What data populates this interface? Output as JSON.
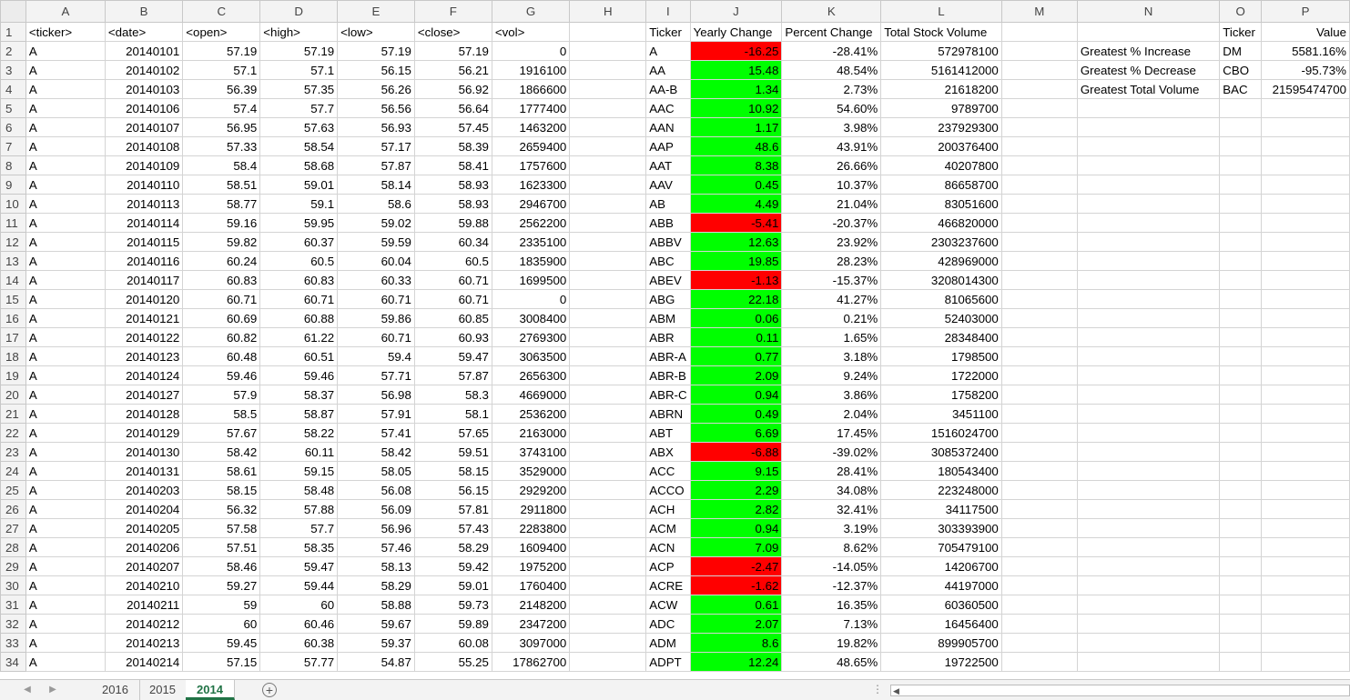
{
  "columns": [
    "A",
    "B",
    "C",
    "D",
    "E",
    "F",
    "G",
    "H",
    "I",
    "J",
    "K",
    "L",
    "M",
    "N",
    "O",
    "P"
  ],
  "rows": [
    {
      "n": "1",
      "A": "<ticker>",
      "B": "<date>",
      "C": "<open>",
      "D": "<high>",
      "E": "<low>",
      "F": "<close>",
      "G": "<vol>",
      "I": "Ticker",
      "J": "Yearly Change",
      "K": "Percent Change",
      "L": "Total Stock Volume",
      "O": "Ticker",
      "P": "Value"
    },
    {
      "n": "2",
      "A": "A",
      "B": "20140101",
      "C": "57.19",
      "D": "57.19",
      "E": "57.19",
      "F": "57.19",
      "G": "0",
      "I": "A",
      "J": "-16.25",
      "K": "-28.41%",
      "L": "572978100",
      "N": "Greatest % Increase",
      "O": "DM",
      "P": "5581.16%"
    },
    {
      "n": "3",
      "A": "A",
      "B": "20140102",
      "C": "57.1",
      "D": "57.1",
      "E": "56.15",
      "F": "56.21",
      "G": "1916100",
      "I": "AA",
      "J": "15.48",
      "K": "48.54%",
      "L": "5161412000",
      "N": "Greatest % Decrease",
      "O": "CBO",
      "P": "-95.73%"
    },
    {
      "n": "4",
      "A": "A",
      "B": "20140103",
      "C": "56.39",
      "D": "57.35",
      "E": "56.26",
      "F": "56.92",
      "G": "1866600",
      "I": "AA-B",
      "J": "1.34",
      "K": "2.73%",
      "L": "21618200",
      "N": "Greatest Total Volume",
      "O": "BAC",
      "P": "21595474700"
    },
    {
      "n": "5",
      "A": "A",
      "B": "20140106",
      "C": "57.4",
      "D": "57.7",
      "E": "56.56",
      "F": "56.64",
      "G": "1777400",
      "I": "AAC",
      "J": "10.92",
      "K": "54.60%",
      "L": "9789700"
    },
    {
      "n": "6",
      "A": "A",
      "B": "20140107",
      "C": "56.95",
      "D": "57.63",
      "E": "56.93",
      "F": "57.45",
      "G": "1463200",
      "I": "AAN",
      "J": "1.17",
      "K": "3.98%",
      "L": "237929300"
    },
    {
      "n": "7",
      "A": "A",
      "B": "20140108",
      "C": "57.33",
      "D": "58.54",
      "E": "57.17",
      "F": "58.39",
      "G": "2659400",
      "I": "AAP",
      "J": "48.6",
      "K": "43.91%",
      "L": "200376400"
    },
    {
      "n": "8",
      "A": "A",
      "B": "20140109",
      "C": "58.4",
      "D": "58.68",
      "E": "57.87",
      "F": "58.41",
      "G": "1757600",
      "I": "AAT",
      "J": "8.38",
      "K": "26.66%",
      "L": "40207800"
    },
    {
      "n": "9",
      "A": "A",
      "B": "20140110",
      "C": "58.51",
      "D": "59.01",
      "E": "58.14",
      "F": "58.93",
      "G": "1623300",
      "I": "AAV",
      "J": "0.45",
      "K": "10.37%",
      "L": "86658700"
    },
    {
      "n": "10",
      "A": "A",
      "B": "20140113",
      "C": "58.77",
      "D": "59.1",
      "E": "58.6",
      "F": "58.93",
      "G": "2946700",
      "I": "AB",
      "J": "4.49",
      "K": "21.04%",
      "L": "83051600"
    },
    {
      "n": "11",
      "A": "A",
      "B": "20140114",
      "C": "59.16",
      "D": "59.95",
      "E": "59.02",
      "F": "59.88",
      "G": "2562200",
      "I": "ABB",
      "J": "-5.41",
      "K": "-20.37%",
      "L": "466820000"
    },
    {
      "n": "12",
      "A": "A",
      "B": "20140115",
      "C": "59.82",
      "D": "60.37",
      "E": "59.59",
      "F": "60.34",
      "G": "2335100",
      "I": "ABBV",
      "J": "12.63",
      "K": "23.92%",
      "L": "2303237600"
    },
    {
      "n": "13",
      "A": "A",
      "B": "20140116",
      "C": "60.24",
      "D": "60.5",
      "E": "60.04",
      "F": "60.5",
      "G": "1835900",
      "I": "ABC",
      "J": "19.85",
      "K": "28.23%",
      "L": "428969000"
    },
    {
      "n": "14",
      "A": "A",
      "B": "20140117",
      "C": "60.83",
      "D": "60.83",
      "E": "60.33",
      "F": "60.71",
      "G": "1699500",
      "I": "ABEV",
      "J": "-1.13",
      "K": "-15.37%",
      "L": "3208014300"
    },
    {
      "n": "15",
      "A": "A",
      "B": "20140120",
      "C": "60.71",
      "D": "60.71",
      "E": "60.71",
      "F": "60.71",
      "G": "0",
      "I": "ABG",
      "J": "22.18",
      "K": "41.27%",
      "L": "81065600"
    },
    {
      "n": "16",
      "A": "A",
      "B": "20140121",
      "C": "60.69",
      "D": "60.88",
      "E": "59.86",
      "F": "60.85",
      "G": "3008400",
      "I": "ABM",
      "J": "0.06",
      "K": "0.21%",
      "L": "52403000"
    },
    {
      "n": "17",
      "A": "A",
      "B": "20140122",
      "C": "60.82",
      "D": "61.22",
      "E": "60.71",
      "F": "60.93",
      "G": "2769300",
      "I": "ABR",
      "J": "0.11",
      "K": "1.65%",
      "L": "28348400"
    },
    {
      "n": "18",
      "A": "A",
      "B": "20140123",
      "C": "60.48",
      "D": "60.51",
      "E": "59.4",
      "F": "59.47",
      "G": "3063500",
      "I": "ABR-A",
      "J": "0.77",
      "K": "3.18%",
      "L": "1798500"
    },
    {
      "n": "19",
      "A": "A",
      "B": "20140124",
      "C": "59.46",
      "D": "59.46",
      "E": "57.71",
      "F": "57.87",
      "G": "2656300",
      "I": "ABR-B",
      "J": "2.09",
      "K": "9.24%",
      "L": "1722000"
    },
    {
      "n": "20",
      "A": "A",
      "B": "20140127",
      "C": "57.9",
      "D": "58.37",
      "E": "56.98",
      "F": "58.3",
      "G": "4669000",
      "I": "ABR-C",
      "J": "0.94",
      "K": "3.86%",
      "L": "1758200"
    },
    {
      "n": "21",
      "A": "A",
      "B": "20140128",
      "C": "58.5",
      "D": "58.87",
      "E": "57.91",
      "F": "58.1",
      "G": "2536200",
      "I": "ABRN",
      "J": "0.49",
      "K": "2.04%",
      "L": "3451100"
    },
    {
      "n": "22",
      "A": "A",
      "B": "20140129",
      "C": "57.67",
      "D": "58.22",
      "E": "57.41",
      "F": "57.65",
      "G": "2163000",
      "I": "ABT",
      "J": "6.69",
      "K": "17.45%",
      "L": "1516024700"
    },
    {
      "n": "23",
      "A": "A",
      "B": "20140130",
      "C": "58.42",
      "D": "60.11",
      "E": "58.42",
      "F": "59.51",
      "G": "3743100",
      "I": "ABX",
      "J": "-6.88",
      "K": "-39.02%",
      "L": "3085372400"
    },
    {
      "n": "24",
      "A": "A",
      "B": "20140131",
      "C": "58.61",
      "D": "59.15",
      "E": "58.05",
      "F": "58.15",
      "G": "3529000",
      "I": "ACC",
      "J": "9.15",
      "K": "28.41%",
      "L": "180543400"
    },
    {
      "n": "25",
      "A": "A",
      "B": "20140203",
      "C": "58.15",
      "D": "58.48",
      "E": "56.08",
      "F": "56.15",
      "G": "2929200",
      "I": "ACCO",
      "J": "2.29",
      "K": "34.08%",
      "L": "223248000"
    },
    {
      "n": "26",
      "A": "A",
      "B": "20140204",
      "C": "56.32",
      "D": "57.88",
      "E": "56.09",
      "F": "57.81",
      "G": "2911800",
      "I": "ACH",
      "J": "2.82",
      "K": "32.41%",
      "L": "34117500"
    },
    {
      "n": "27",
      "A": "A",
      "B": "20140205",
      "C": "57.58",
      "D": "57.7",
      "E": "56.96",
      "F": "57.43",
      "G": "2283800",
      "I": "ACM",
      "J": "0.94",
      "K": "3.19%",
      "L": "303393900"
    },
    {
      "n": "28",
      "A": "A",
      "B": "20140206",
      "C": "57.51",
      "D": "58.35",
      "E": "57.46",
      "F": "58.29",
      "G": "1609400",
      "I": "ACN",
      "J": "7.09",
      "K": "8.62%",
      "L": "705479100"
    },
    {
      "n": "29",
      "A": "A",
      "B": "20140207",
      "C": "58.46",
      "D": "59.47",
      "E": "58.13",
      "F": "59.42",
      "G": "1975200",
      "I": "ACP",
      "J": "-2.47",
      "K": "-14.05%",
      "L": "14206700"
    },
    {
      "n": "30",
      "A": "A",
      "B": "20140210",
      "C": "59.27",
      "D": "59.44",
      "E": "58.29",
      "F": "59.01",
      "G": "1760400",
      "I": "ACRE",
      "J": "-1.62",
      "K": "-12.37%",
      "L": "44197000"
    },
    {
      "n": "31",
      "A": "A",
      "B": "20140211",
      "C": "59",
      "D": "60",
      "E": "58.88",
      "F": "59.73",
      "G": "2148200",
      "I": "ACW",
      "J": "0.61",
      "K": "16.35%",
      "L": "60360500"
    },
    {
      "n": "32",
      "A": "A",
      "B": "20140212",
      "C": "60",
      "D": "60.46",
      "E": "59.67",
      "F": "59.89",
      "G": "2347200",
      "I": "ADC",
      "J": "2.07",
      "K": "7.13%",
      "L": "16456400"
    },
    {
      "n": "33",
      "A": "A",
      "B": "20140213",
      "C": "59.45",
      "D": "60.38",
      "E": "59.37",
      "F": "60.08",
      "G": "3097000",
      "I": "ADM",
      "J": "8.6",
      "K": "19.82%",
      "L": "899905700"
    },
    {
      "n": "34",
      "A": "A",
      "B": "20140214",
      "C": "57.15",
      "D": "57.77",
      "E": "54.87",
      "F": "55.25",
      "G": "17862700",
      "I": "ADPT",
      "J": "12.24",
      "K": "48.65%",
      "L": "19722500"
    }
  ],
  "sheet_tabs": [
    {
      "label": "2016",
      "active": false
    },
    {
      "label": "2015",
      "active": false
    },
    {
      "label": "2014",
      "active": true
    }
  ],
  "colors": {
    "positive": "#00ff00",
    "negative": "#ff0000",
    "active_tab": "#217346"
  },
  "icons": {
    "prev": "triangle-left",
    "next": "triangle-right",
    "add_sheet": "plus-circle",
    "more": "ellipsis",
    "scroll_left": "triangle-left"
  }
}
